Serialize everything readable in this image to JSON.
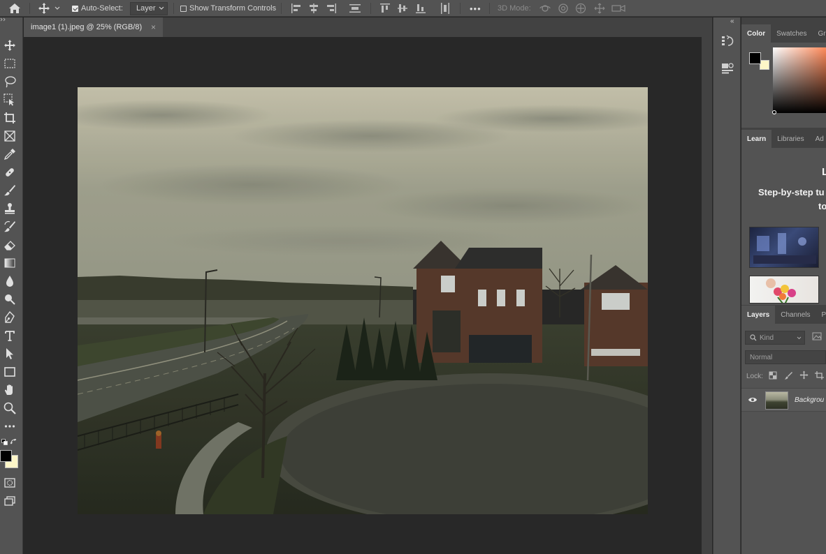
{
  "options_bar": {
    "auto_select_label": "Auto-Select:",
    "auto_select_checked": true,
    "layer_select_value": "Layer",
    "transform_label": "Show Transform Controls",
    "transform_checked": false,
    "more_label": "•••",
    "mode_3d_label": "3D Mode:"
  },
  "document": {
    "tab_title": "image1 (1).jpeg @ 25% (RGB/8)",
    "tab_close": "×",
    "zoom": "25%",
    "color_mode": "RGB/8"
  },
  "panels": {
    "collapse_glyph": "«",
    "color_tabs": [
      "Color",
      "Swatches",
      "Gr"
    ],
    "learn_tabs": [
      "Learn",
      "Libraries",
      "Ad"
    ],
    "learn_heading": "L",
    "learn_subtitle_line1": "Step-by-step tu",
    "learn_subtitle_line2": "to",
    "layers_tabs": [
      "Layers",
      "Channels",
      "P"
    ],
    "kind_placeholder": "Kind",
    "blend_mode": "Normal",
    "lock_label": "Lock:",
    "layer_name": "Backgrou"
  },
  "colors": {
    "foreground": "#000000",
    "background": "#fdf6c8",
    "accent": "#dcdcdc"
  }
}
